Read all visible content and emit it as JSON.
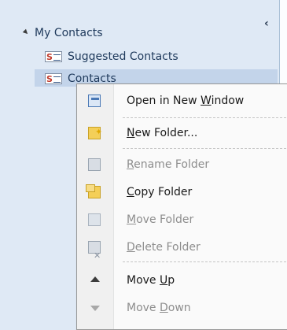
{
  "navigation": {
    "group_label": "My Contacts",
    "collapse_glyph": "‹",
    "items": [
      {
        "label": "Suggested Contacts",
        "icon": "contact-card-icon"
      },
      {
        "label": "Contacts",
        "icon": "contact-card-icon",
        "selected": true
      }
    ]
  },
  "context_menu": {
    "items": [
      {
        "pre": "Open in New ",
        "key": "W",
        "post": "indow",
        "icon": "window-icon",
        "enabled": true
      },
      {
        "pre": "",
        "key": "N",
        "post": "ew Folder...",
        "icon": "new-folder-icon",
        "enabled": true
      },
      {
        "pre": "",
        "key": "R",
        "post": "ename Folder",
        "icon": "rename-folder-icon",
        "enabled": false
      },
      {
        "pre": "",
        "key": "C",
        "post": "opy Folder",
        "icon": "copy-folder-icon",
        "enabled": true
      },
      {
        "pre": "",
        "key": "M",
        "post": "ove Folder",
        "icon": "move-folder-icon",
        "enabled": false
      },
      {
        "pre": "",
        "key": "D",
        "post": "elete Folder",
        "icon": "delete-folder-icon",
        "enabled": false
      },
      {
        "pre": "Move ",
        "key": "U",
        "post": "p",
        "icon": "arrow-up-icon",
        "enabled": true
      },
      {
        "pre": "Move ",
        "key": "D",
        "post": "own",
        "icon": "arrow-down-icon",
        "enabled": false
      }
    ]
  }
}
